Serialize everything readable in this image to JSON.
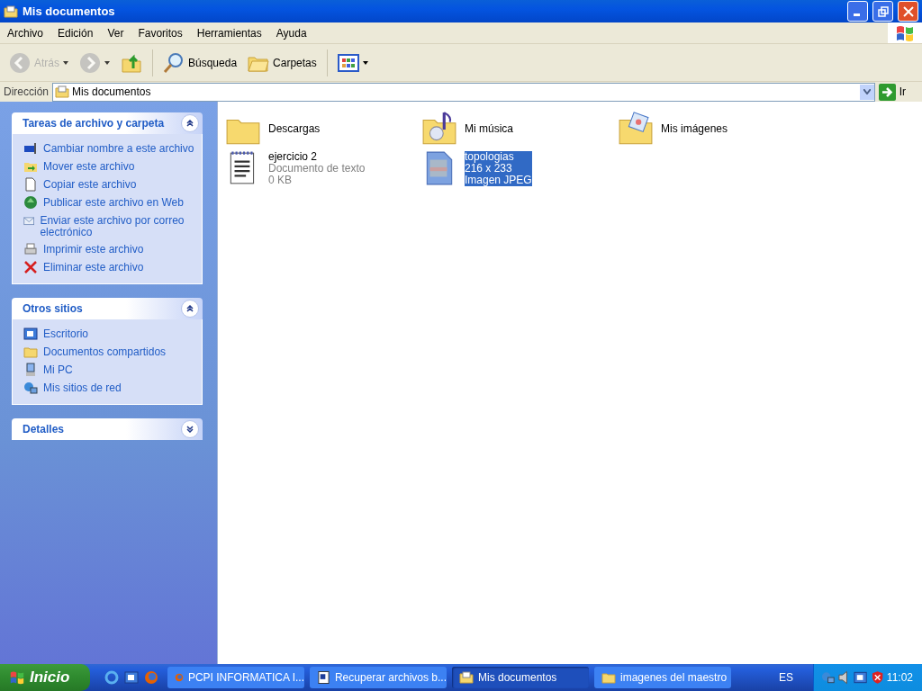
{
  "window": {
    "title": "Mis documentos"
  },
  "menu": [
    "Archivo",
    "Edición",
    "Ver",
    "Favoritos",
    "Herramientas",
    "Ayuda"
  ],
  "toolbar": [
    {
      "kind": "back",
      "label": "Atrás",
      "disabled": true
    },
    {
      "kind": "forward",
      "disabled": true
    },
    {
      "kind": "up",
      "disabled": false
    },
    {
      "kind": "search",
      "label": "Búsqueda",
      "disabled": false
    },
    {
      "kind": "folders",
      "label": "Carpetas",
      "disabled": false
    },
    {
      "kind": "views",
      "disabled": false
    }
  ],
  "address": {
    "label": "Dirección",
    "value": "Mis documentos",
    "go": "Ir"
  },
  "sidebar": [
    {
      "title": "Tareas de archivo y carpeta",
      "expanded": true,
      "items": [
        {
          "kind": "rename",
          "label": "Cambiar nombre a este archivo"
        },
        {
          "kind": "move",
          "label": "Mover este archivo"
        },
        {
          "kind": "copy",
          "label": "Copiar este archivo"
        },
        {
          "kind": "web",
          "label": "Publicar este archivo en Web"
        },
        {
          "kind": "mail",
          "label": "Enviar este archivo por correo electrónico"
        },
        {
          "kind": "print",
          "label": "Imprimir este archivo"
        },
        {
          "kind": "delete",
          "label": "Eliminar este archivo"
        }
      ]
    },
    {
      "title": "Otros sitios",
      "expanded": true,
      "items": [
        {
          "kind": "desktop",
          "label": "Escritorio"
        },
        {
          "kind": "folder",
          "label": "Documentos compartidos"
        },
        {
          "kind": "pc",
          "label": "Mi PC"
        },
        {
          "kind": "network",
          "label": "Mis sitios de red"
        }
      ]
    },
    {
      "title": "Detalles",
      "expanded": false
    }
  ],
  "files": [
    {
      "kind": "folder",
      "name": "Descargas",
      "selected": false
    },
    {
      "kind": "music",
      "name": "Mi música",
      "selected": false
    },
    {
      "kind": "pictures",
      "name": "Mis imágenes",
      "selected": false
    },
    {
      "kind": "text",
      "name": "ejercicio 2",
      "type": "Documento de texto",
      "size": "0 KB",
      "selected": false
    },
    {
      "kind": "image",
      "name": "topologias",
      "type": "216 x 233",
      "size": "Imagen JPEG",
      "selected": true
    }
  ],
  "taskbar": {
    "start": "Inicio",
    "buttons": [
      {
        "kind": "firefox",
        "label": "PCPI INFORMATICA I...",
        "selected": false
      },
      {
        "kind": "word",
        "label": "Recuperar archivos b...",
        "selected": false
      },
      {
        "kind": "explorer",
        "label": "Mis documentos",
        "selected": true
      },
      {
        "kind": "folder",
        "label": "imagenes del maestro",
        "selected": false
      }
    ],
    "language": "ES",
    "clock": "11:02"
  }
}
